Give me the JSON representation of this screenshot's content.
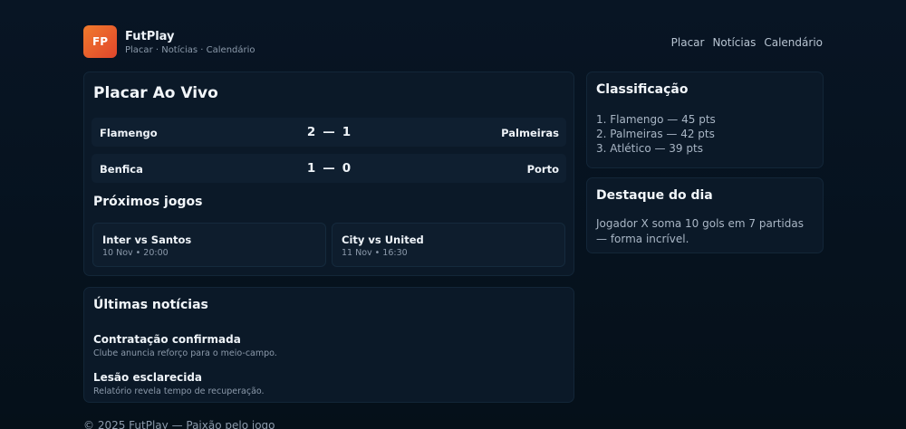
{
  "brand": {
    "logo_text": "FP",
    "name": "FutPlay",
    "tagline": "Placar · Notícias · Calendário"
  },
  "nav": {
    "items": [
      "Placar",
      "Notícias",
      "Calendário"
    ]
  },
  "live": {
    "title": "Placar Ao Vivo",
    "matches": [
      {
        "home": "Flamengo",
        "home_score": "2",
        "separator": "—",
        "away_score": "1",
        "away": "Palmeiras"
      },
      {
        "home": "Benfica",
        "home_score": "1",
        "separator": "—",
        "away_score": "0",
        "away": "Porto"
      }
    ],
    "upcoming_title": "Próximos jogos",
    "upcoming": [
      {
        "teams": "Inter vs Santos",
        "when": "10 Nov • 20:00"
      },
      {
        "teams": "City vs United",
        "when": "11 Nov • 16:30"
      }
    ]
  },
  "news": {
    "title": "Últimas notícias",
    "items": [
      {
        "headline": "Contratação confirmada",
        "summary": "Clube anuncia reforço para o meio-campo."
      },
      {
        "headline": "Lesão esclarecida",
        "summary": "Relatório revela tempo de recuperação."
      }
    ]
  },
  "standings": {
    "title": "Classificação",
    "rows": [
      "1. Flamengo — 45 pts",
      "2. Palmeiras — 42 pts",
      "3. Atlético — 39 pts"
    ]
  },
  "highlight": {
    "title": "Destaque do dia",
    "text": "Jogador X soma 10 gols em 7 partidas — forma incrível."
  },
  "footer": {
    "text": "© 2025 FutPlay — Paixão pelo jogo"
  },
  "colors": {
    "background": "#071420",
    "card": "#0b1928",
    "logo_gradient_start": "#f07a2c",
    "logo_gradient_end": "#e1462c"
  }
}
